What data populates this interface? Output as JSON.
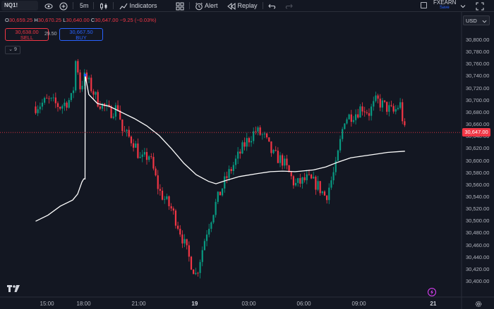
{
  "toolbar": {
    "symbol": "NQ1!",
    "interval": "5m",
    "indicators_label": "Indicators",
    "alert_label": "Alert",
    "replay_label": "Replay",
    "account_name": "FXEARN",
    "account_sub": "Save"
  },
  "legend": {
    "o_label": "O",
    "o_val": "30,659.25",
    "h_label": "H",
    "h_val": "30,670.25",
    "l_label": "L",
    "l_val": "30,640.00",
    "c_label": "C",
    "c_val": "30,647.00",
    "change": "−9.25 (−0.03%)"
  },
  "trade": {
    "sell_price": "30,638.00",
    "sell_label": "SELL",
    "spread": "29.50",
    "buy_price": "30,667.50",
    "buy_label": "BUY",
    "indicator_count": "9"
  },
  "price_axis": {
    "currency": "USD",
    "labels": [
      "30,800.00",
      "30,780.00",
      "30,760.00",
      "30,740.00",
      "30,720.00",
      "30,700.00",
      "30,680.00",
      "30,660.00",
      "30,640.00",
      "30,620.00",
      "30,600.00",
      "30,580.00",
      "30,560.00",
      "30,540.00",
      "30,520.00",
      "30,500.00",
      "30,480.00",
      "30,460.00",
      "30,440.00",
      "30,420.00",
      "30,400.00"
    ],
    "current_price": "30,647.00"
  },
  "time_axis": {
    "labels": [
      "15:00",
      "18:00",
      "21:00",
      "19",
      "03:00",
      "06:00",
      "09:00",
      "21"
    ],
    "bold": [
      false,
      false,
      false,
      true,
      false,
      false,
      false,
      true
    ]
  },
  "colors": {
    "up": "#089981",
    "down": "#f23645",
    "vwap": "#ffffff",
    "background": "#131722"
  },
  "chart_data": {
    "type": "candlestick",
    "symbol": "NQ1!",
    "interval": "5m",
    "ylim": [
      30385,
      30815
    ],
    "xlim": [
      14.0,
      44.2
    ],
    "last_close": 30647.0,
    "series": [
      {
        "name": "price",
        "x": [
          14.0,
          15.0,
          16.0,
          17.0,
          17.3,
          17.55,
          18.0,
          18.4,
          19.0,
          20.0,
          20.7,
          21.0,
          22.0,
          22.5,
          23.2,
          24.0,
          25.0,
          25.6,
          26.4,
          27.0,
          27.8,
          28.6,
          29.4,
          30.2,
          31.0,
          31.8,
          32.5,
          33.2,
          34.0,
          35.0,
          36.0,
          36.8,
          37.5,
          38.3,
          39.0,
          40.0,
          40.4,
          41.0,
          41.6,
          42.3,
          43.0,
          43.5,
          43.9
        ],
        "values": [
          30690,
          30700,
          30690,
          30705,
          30780,
          30720,
          30740,
          30725,
          30700,
          30680,
          30690,
          30650,
          30630,
          30600,
          30610,
          30550,
          30520,
          30490,
          30440,
          30410,
          30480,
          30530,
          30570,
          30600,
          30630,
          30650,
          30640,
          30610,
          30600,
          30560,
          30570,
          30560,
          30540,
          30590,
          30670,
          30680,
          30690,
          30680,
          30700,
          30690,
          30680,
          30695,
          30647
        ]
      },
      {
        "name": "vwap",
        "x": [
          14.0,
          15.0,
          16.0,
          17.0,
          17.4,
          17.75,
          17.9,
          18.0,
          18.01,
          18.3,
          19.0,
          20.0,
          21.0,
          22.0,
          23.0,
          24.0,
          25.0,
          26.0,
          27.0,
          28.0,
          28.6,
          29.5,
          30.5,
          32.0,
          33.0,
          34.0,
          35.0,
          35.5,
          36.5,
          37.5,
          38.5,
          39.5,
          40.5,
          41.5,
          42.5,
          43.9
        ],
        "values": [
          30500,
          30510,
          30525,
          30535,
          30545,
          30565,
          30570,
          30570,
          30742,
          30710,
          30695,
          30690,
          30680,
          30670,
          30658,
          30642,
          30620,
          30596,
          30577,
          30566,
          30562,
          30568,
          30574,
          30579,
          30582,
          30583,
          30582,
          30583,
          30585,
          30590,
          30598,
          30605,
          30608,
          30611,
          30614,
          30616
        ]
      }
    ]
  }
}
